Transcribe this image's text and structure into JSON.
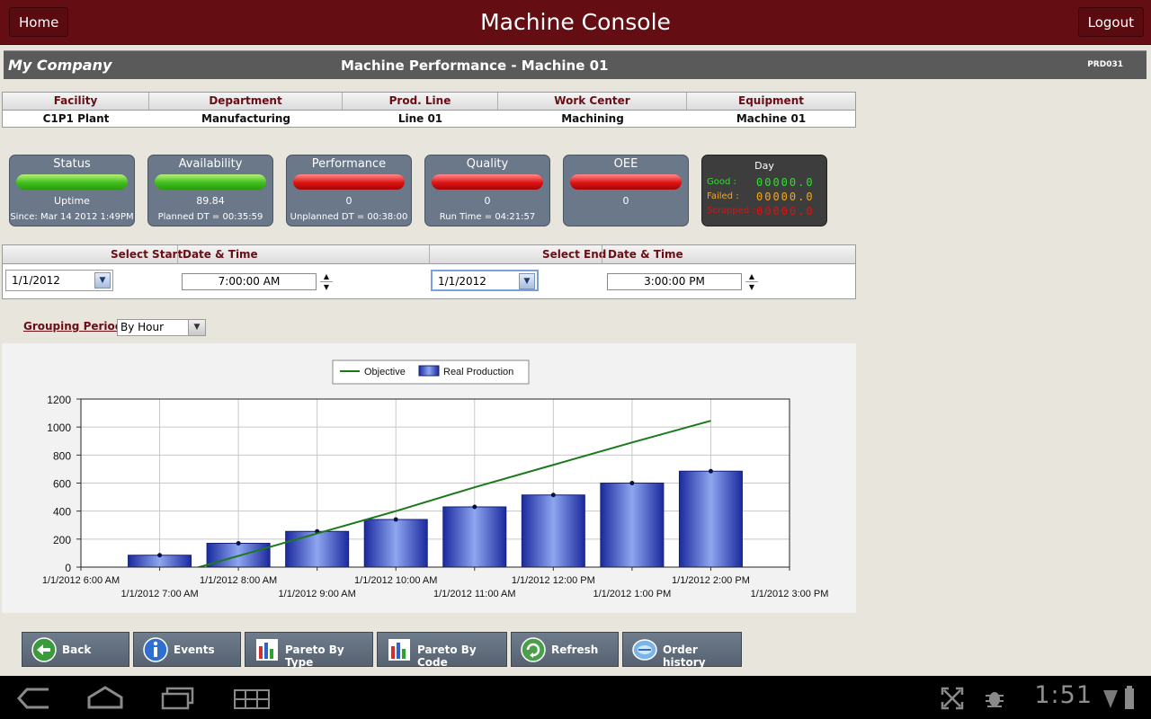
{
  "topbar": {
    "title": "Machine Console",
    "home_label": "Home",
    "logout_label": "Logout"
  },
  "banner": {
    "company": "My Company",
    "title": "Machine Performance - Machine 01",
    "code": "PRD031"
  },
  "info": {
    "headers": [
      "Facility",
      "Department",
      "Prod. Line",
      "Work Center",
      "Equipment"
    ],
    "values": [
      "C1P1 Plant",
      "Manufacturing",
      "Line 01",
      "Machining",
      "Machine 01"
    ]
  },
  "tiles": [
    {
      "name": "Status",
      "value": "Uptime",
      "sub": "Since: Mar 14 2012  1:49PM",
      "state": "green"
    },
    {
      "name": "Availability",
      "value": "89.84",
      "sub": "Planned DT = 00:35:59",
      "state": "green"
    },
    {
      "name": "Performance",
      "value": "0",
      "sub": "Unplanned DT = 00:38:00",
      "state": "red"
    },
    {
      "name": "Quality",
      "value": "0",
      "sub": "Run Time = 04:21:57",
      "state": "red"
    },
    {
      "name": "OEE",
      "value": "0",
      "sub": "",
      "state": "red"
    }
  ],
  "day": {
    "title": "Day",
    "good_label": "Good :",
    "good_value": "00000.0",
    "good_color": "#33dd33",
    "failed_label": "Failed :",
    "failed_value": "00000.0",
    "failed_color": "#f2a91a",
    "scrapped_label": "Scrapped :",
    "scrapped_value": "00000.0",
    "scrapped_color": "#dd1111"
  },
  "selection": {
    "start_label": "Select Start",
    "start_dt_label": "Date & Time",
    "end_label": "Select End",
    "end_dt_label": "Date & Time",
    "start_date": "1/1/2012",
    "start_time": "7:00:00 AM",
    "end_date": "1/1/2012",
    "end_time": "3:00:00 PM"
  },
  "grouping": {
    "label": "Grouping Period:",
    "value": "By Hour"
  },
  "chart_data": {
    "type": "bar",
    "x": [
      "1/1/2012 6:00 AM",
      "1/1/2012 7:00 AM",
      "1/1/2012 8:00 AM",
      "1/1/2012 9:00 AM",
      "1/1/2012 10:00 AM",
      "1/1/2012 11:00 AM",
      "1/1/2012 12:00 PM",
      "1/1/2012 1:00 PM",
      "1/1/2012 2:00 PM",
      "1/1/2012 3:00 PM"
    ],
    "categories": [
      "1/1/2012 7:00 AM",
      "1/1/2012 8:00 AM",
      "1/1/2012 9:00 AM",
      "1/1/2012 10:00 AM",
      "1/1/2012 11:00 AM",
      "1/1/2012 12:00 PM",
      "1/1/2012 1:00 PM",
      "1/1/2012 2:00 PM"
    ],
    "series": [
      {
        "name": "Real Production",
        "type": "bar",
        "values": [
          85,
          170,
          255,
          340,
          430,
          515,
          600,
          685
        ],
        "color": "#2b3fc4"
      },
      {
        "name": "Objective",
        "type": "line",
        "values": [
          -80,
          80,
          240,
          400,
          570,
          730,
          890,
          1045
        ],
        "color": "#1a7a1a"
      }
    ],
    "yticks": [
      0,
      200,
      400,
      600,
      800,
      1000,
      1200
    ],
    "ylim": [
      0,
      1200
    ],
    "legend": "top-center",
    "grid": true
  },
  "actions": [
    {
      "label": "Back",
      "icon": "back-arrow-icon"
    },
    {
      "label": "Events",
      "icon": "info-icon"
    },
    {
      "label": "Pareto By Type",
      "icon": "bar-chart-icon"
    },
    {
      "label": "Pareto By Code",
      "icon": "bar-chart-icon"
    },
    {
      "label": "Refresh",
      "icon": "refresh-icon"
    },
    {
      "label": "Order history",
      "icon": "order-history-icon"
    }
  ],
  "navbar": {
    "clock": "1:51"
  }
}
